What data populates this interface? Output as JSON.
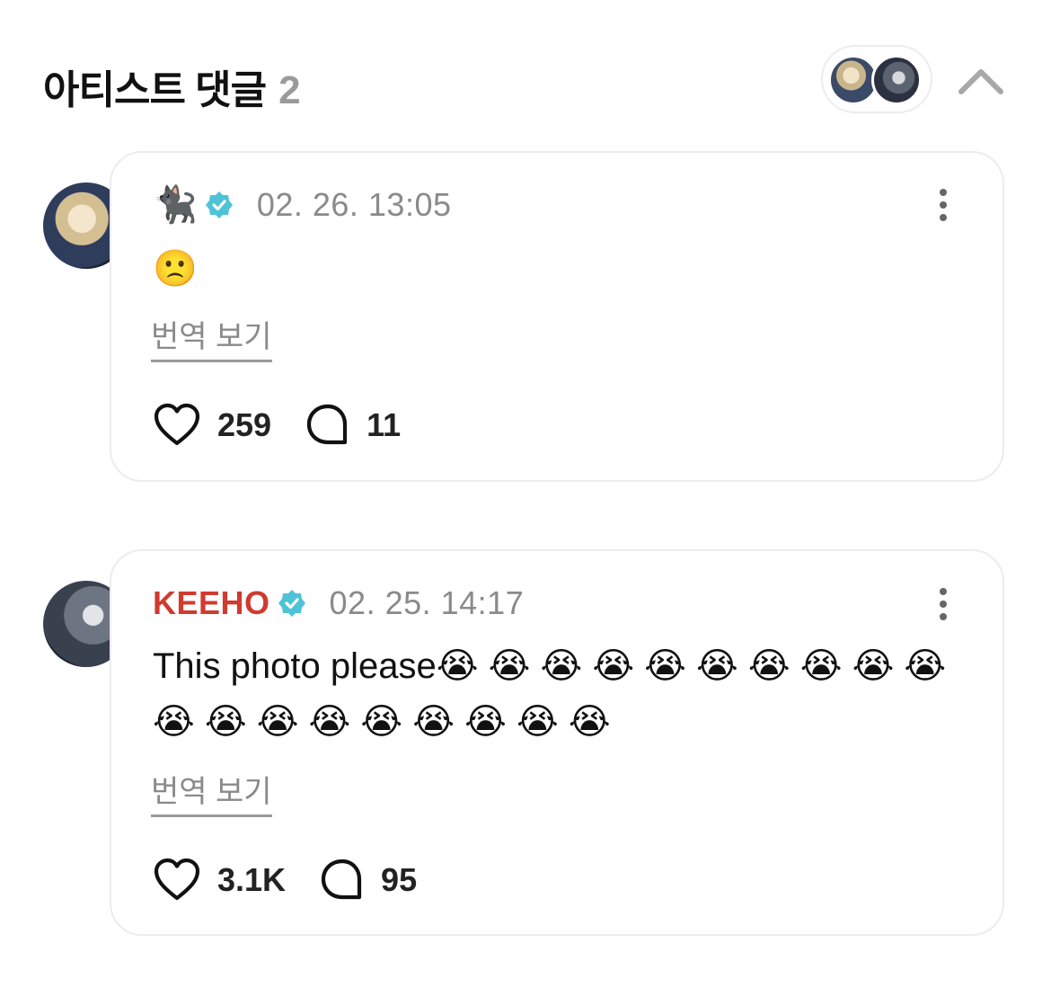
{
  "header": {
    "title": "아티스트 댓글",
    "count": "2"
  },
  "comments": [
    {
      "author_emoji": "🐈‍⬛",
      "timestamp": "02. 26. 13:05",
      "text": "🙁",
      "translate_label": "번역 보기",
      "likes": "259",
      "replies": "11"
    },
    {
      "author": "KEEHO",
      "timestamp": "02. 25. 14:17",
      "text": "This photo please😭 😭 😭 😭 😭 😭 😭 😭 😭 😭 😭 😭 😭 😭 😭 😭 😭 😭 😭",
      "translate_label": "번역 보기",
      "likes": "3.1K",
      "replies": "95"
    }
  ],
  "icons": {
    "verified": "verified-badge-icon",
    "like": "heart-icon",
    "reply": "comment-bubble-icon",
    "more": "more-vertical-icon",
    "collapse": "chevron-up-icon"
  },
  "colors": {
    "verified": "#4fc3d6",
    "author_name": "#d03a2f",
    "muted_text": "#8a8a8a",
    "card_border": "#ececf0"
  }
}
